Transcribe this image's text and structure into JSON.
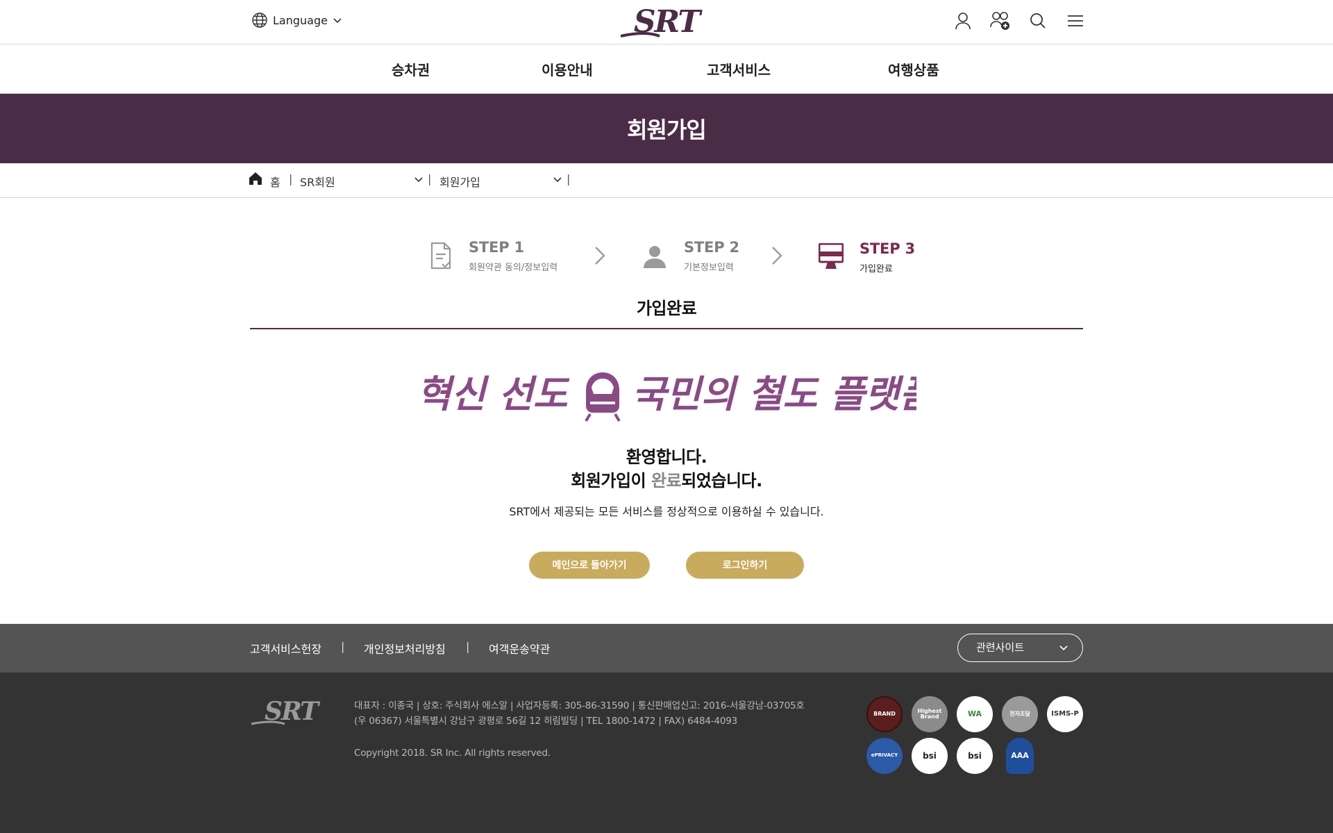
{
  "header": {
    "language_label": "Language",
    "logo_text": "SRT",
    "icons": [
      "user-icon",
      "add-user-icon",
      "search-icon",
      "menu-icon"
    ]
  },
  "gnb": {
    "items": [
      "승차권",
      "이용안내",
      "고객서비스",
      "여행상품"
    ]
  },
  "page_title": "회원가입",
  "breadcrumb": {
    "home": "홈",
    "level1": "SR회원",
    "level2": "회원가입"
  },
  "steps": [
    {
      "title": "STEP 1",
      "subtitle": "회원약관 동의/정보입력"
    },
    {
      "title": "STEP 2",
      "subtitle": "기본정보입력"
    },
    {
      "title": "STEP 3",
      "subtitle": "가입완료"
    }
  ],
  "section_title": "가입완료",
  "slogan": {
    "part1": "혁신 선도",
    "part2": "국민의 철도 플랫폼"
  },
  "welcome": {
    "line1": "환영합니다.",
    "line2_prefix": "회원가입이 ",
    "line2_accent": "완료",
    "line2_suffix": "되었습니다.",
    "description": "SRT에서 제공되는 모든 서비스를 정상적으로 이용하실 수 있습니다."
  },
  "buttons": {
    "go_main": "메인으로 돌아가기",
    "login": "로그인하기"
  },
  "footer": {
    "links": [
      "고객서비스헌장",
      "개인정보처리방침",
      "여객운송약관"
    ],
    "separator": "|",
    "related_sites": "관련사이트",
    "logo_text": "SRT",
    "info_line1": "대표자 : 이종국 | 상호: 주식회사 에스알 | 사업자등록: 305-86-31590 | 통신판매업신고: 2016-서울강남-03705호",
    "info_line2": "(우 06367) 서울특별시 강남구 광평로 56길 12 히림빌딩 | TEL 1800-1472 | FAX) 6484-4093",
    "copyright": "Copyright 2018. SR Inc. All rights reserved.",
    "badges": [
      {
        "name": "brand-award-badge",
        "text": "BRAND",
        "color": "#5a1e1e"
      },
      {
        "name": "highest-brand-badge",
        "text": "Highest Brand",
        "color": "#8b8b8b"
      },
      {
        "name": "wa-mark-badge",
        "text": "WA",
        "color": "#ffffff"
      },
      {
        "name": "e-gov-badge",
        "text": "전자조달",
        "color": "#9a9a9a"
      },
      {
        "name": "isms-p-badge",
        "text": "ISMS-P",
        "color": "#ffffff"
      },
      {
        "name": "eprivacy-badge",
        "text": "ePRIVACY",
        "color": "#2a5aa8"
      },
      {
        "name": "bsi-badge-1",
        "text": "bsi",
        "color": "#ffffff"
      },
      {
        "name": "bsi-badge-2",
        "text": "bsi",
        "color": "#ffffff"
      },
      {
        "name": "aaa-rating-badge",
        "text": "AAA",
        "color": "#1f4f9c"
      }
    ]
  },
  "colors": {
    "brand_purple": "#4b2c47",
    "step_active": "#7a2a4e",
    "button_gold": "#c8ab5c",
    "slogan_purple": "#8a4a86"
  }
}
